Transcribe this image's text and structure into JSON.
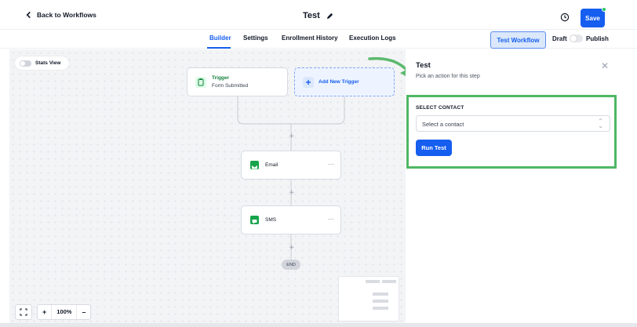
{
  "header": {
    "back_label": "Back to Workflows",
    "title": "Test",
    "save_label": "Save"
  },
  "tabs": [
    {
      "label": "Builder",
      "active": true
    },
    {
      "label": "Settings"
    },
    {
      "label": "Enrollment History"
    },
    {
      "label": "Execution Logs"
    }
  ],
  "toolbar": {
    "test_workflow_label": "Test Workflow",
    "draft_label": "Draft",
    "publish_label": "Publish"
  },
  "canvas": {
    "stats_view_label": "Stats View",
    "trigger": {
      "title": "Trigger",
      "subtitle": "Form Submitted"
    },
    "add_trigger_label": "Add New Trigger",
    "actions": [
      {
        "label": "Email",
        "icon": "email-icon"
      },
      {
        "label": "SMS",
        "icon": "sms-icon"
      }
    ],
    "end_label": "END",
    "zoom": {
      "level": "100%",
      "plus": "+",
      "minus": "–"
    }
  },
  "panel": {
    "title": "Test",
    "subtitle": "Pick an action for this step",
    "select_label": "SELECT CONTACT",
    "select_placeholder": "Select a contact",
    "run_label": "Run Test"
  },
  "colors": {
    "primary": "#155eef",
    "highlight": "#4fb764",
    "trigger_green": "#15803d"
  }
}
